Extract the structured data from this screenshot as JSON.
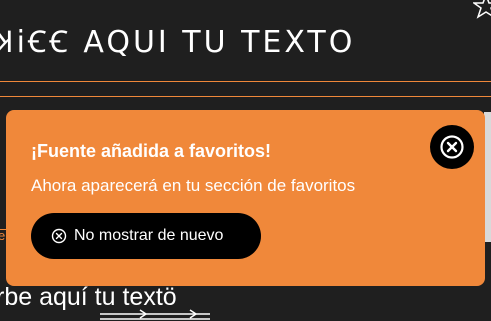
{
  "preview": {
    "title_sample": "ꞰiꞒꞒ AQUI TU TEXTO",
    "left_fragment": "el",
    "bottom_sample": "rbe aquí tu textö"
  },
  "toast": {
    "title": "¡Fuente añadida a favoritos!",
    "message": "Ahora aparecerá en tu sección de favoritos",
    "dismiss_label": "No mostrar de nuevo",
    "close_icon": "close-circle-icon",
    "dismiss_icon": "close-circle-icon"
  },
  "colors": {
    "accent": "#f0883a",
    "background": "#1f1f1f",
    "button": "#000000"
  }
}
